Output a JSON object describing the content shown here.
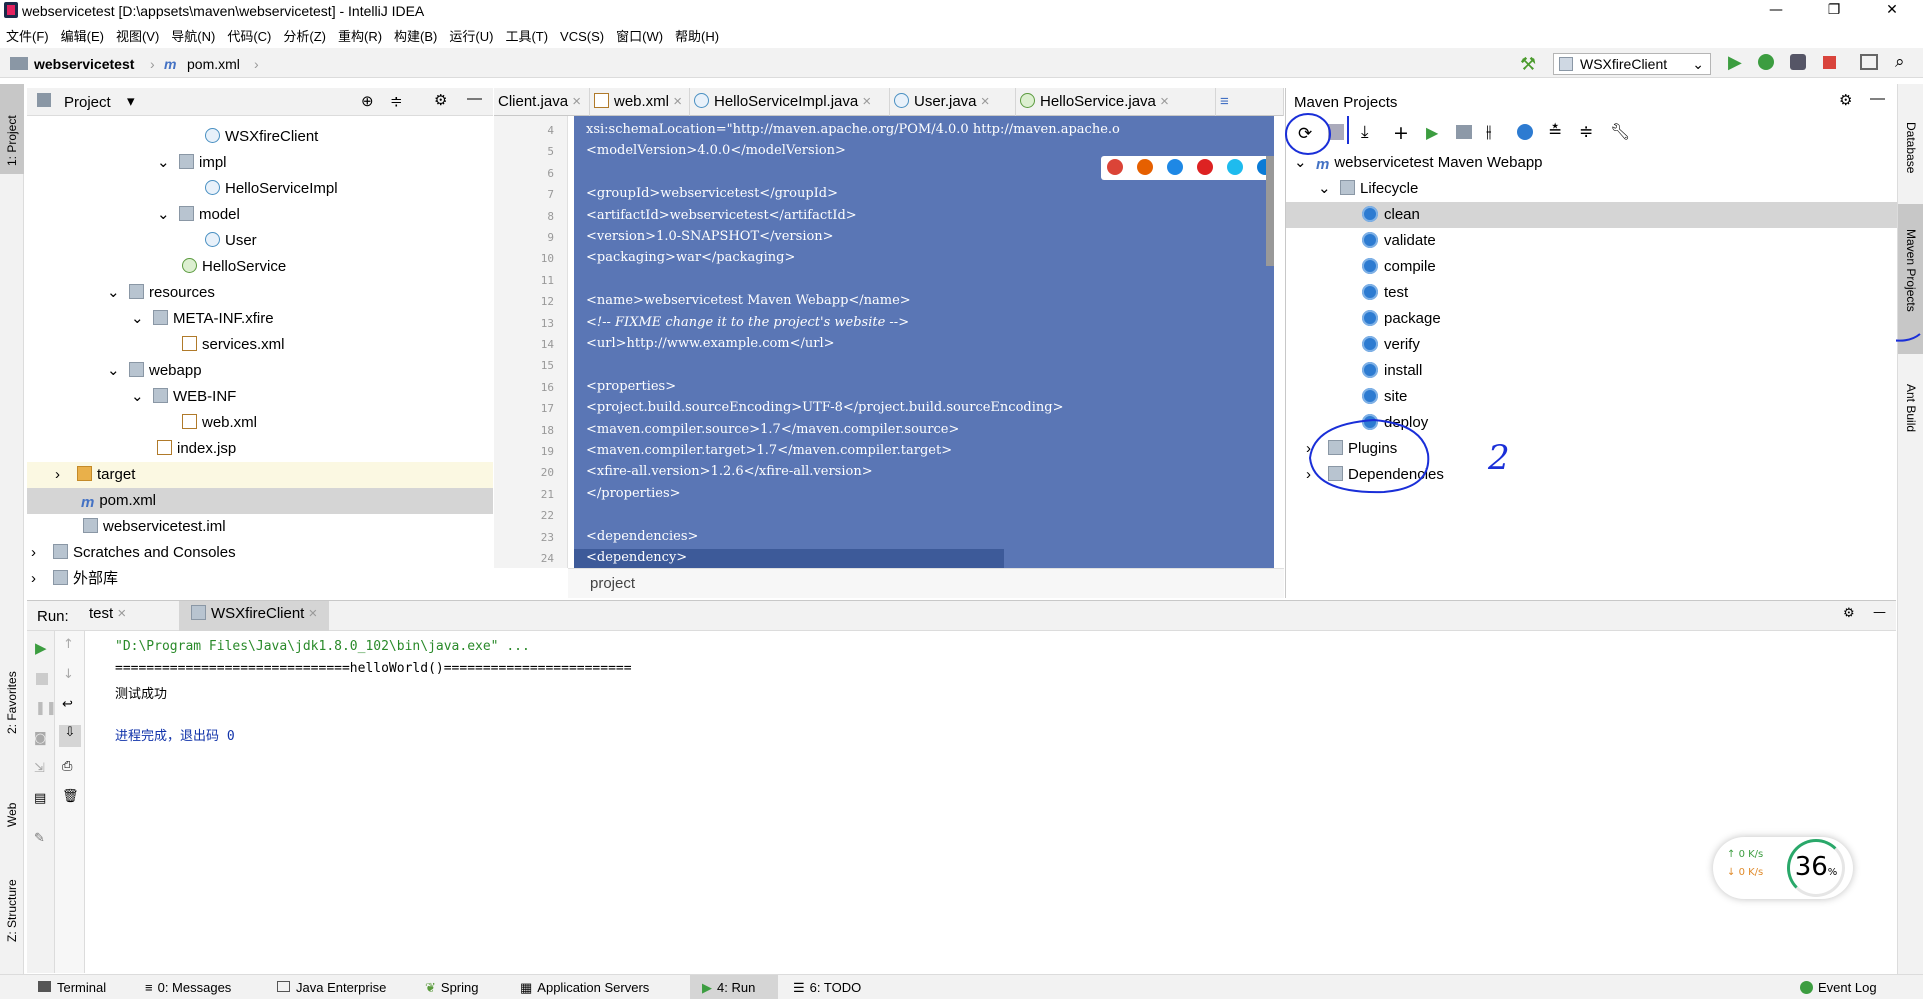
{
  "window": {
    "title": "webservicetest [D:\\appsets\\maven\\webservicetest] - IntelliJ IDEA",
    "minimize": "—",
    "restore": "❐",
    "close": "✕"
  },
  "menu": [
    "文件(F)",
    "编辑(E)",
    "视图(V)",
    "导航(N)",
    "代码(C)",
    "分析(Z)",
    "重构(R)",
    "构建(B)",
    "运行(U)",
    "工具(T)",
    "VCS(S)",
    "窗口(W)",
    "帮助(H)"
  ],
  "breadcrumb": {
    "project": "webservicetest",
    "file": "pom.xml"
  },
  "run_config": "WSXfireClient",
  "left_strip": {
    "project": "1: Project",
    "favorites": "2: Favorites",
    "web": "Web",
    "structure": "Z: Structure"
  },
  "right_strip": {
    "database": "Database",
    "maven": "Maven Projects",
    "ant": "Ant Build"
  },
  "project_panel": {
    "title": "Project",
    "items": [
      {
        "label": "WSXfireClient",
        "icon": "class-icon"
      },
      {
        "label": "impl",
        "icon": "package-icon"
      },
      {
        "label": "HelloServiceImpl",
        "icon": "class-icon"
      },
      {
        "label": "model",
        "icon": "package-icon"
      },
      {
        "label": "User",
        "icon": "class-icon"
      },
      {
        "label": "HelloService",
        "icon": "interface-icon"
      },
      {
        "label": "resources",
        "icon": "folder-icon"
      },
      {
        "label": "META-INF.xfire",
        "icon": "folder-icon"
      },
      {
        "label": "services.xml",
        "icon": "xml-icon"
      },
      {
        "label": "webapp",
        "icon": "folder-icon"
      },
      {
        "label": "WEB-INF",
        "icon": "folder-icon"
      },
      {
        "label": "web.xml",
        "icon": "xml-icon"
      },
      {
        "label": "index.jsp",
        "icon": "jsp-icon"
      },
      {
        "label": "target",
        "icon": "folder-icon"
      },
      {
        "label": "pom.xml",
        "icon": "maven-icon"
      },
      {
        "label": "webservicetest.iml",
        "icon": "iml-icon"
      },
      {
        "label": "Scratches and Consoles",
        "icon": "scratch-icon"
      },
      {
        "label": "外部库",
        "icon": "library-icon"
      }
    ]
  },
  "editor": {
    "tabs": [
      "Client.java",
      "web.xml",
      "HelloServiceImpl.java",
      "User.java",
      "HelloService.java"
    ],
    "line_numbers": [
      "4",
      "5",
      "6",
      "7",
      "8",
      "9",
      "10",
      "11",
      "12",
      "13",
      "14",
      "15",
      "16",
      "17",
      "18",
      "19",
      "20",
      "21",
      "22",
      "23",
      "24"
    ],
    "lines": [
      "xsi:schemaLocation=\"http://maven.apache.org/POM/4.0.0 http://maven.apache.o",
      "<modelVersion>4.0.0</modelVersion>",
      "",
      "<groupId>webservicetest</groupId>",
      "<artifactId>webservicetest</artifactId>",
      "<version>1.0-SNAPSHOT</version>",
      "<packaging>war</packaging>",
      "",
      "<name>webservicetest Maven Webapp</name>",
      "<!-- FIXME change it to the project's website -->",
      "<url>http://www.example.com</url>",
      "",
      "<properties>",
      "  <project.build.sourceEncoding>UTF-8</project.build.sourceEncoding>",
      "  <maven.compiler.source>1.7</maven.compiler.source>",
      "  <maven.compiler.target>1.7</maven.compiler.target>",
      "  <xfire-all.version>1.2.6</xfire-all.version>",
      "</properties>",
      "",
      "<dependencies>",
      "  <dependency>"
    ],
    "footer": "project"
  },
  "maven": {
    "title": "Maven Projects",
    "root": "webservicetest Maven Webapp",
    "lifecycle": "Lifecycle",
    "goals": [
      "clean",
      "validate",
      "compile",
      "test",
      "package",
      "verify",
      "install",
      "site",
      "deploy"
    ],
    "plugins": "Plugins",
    "dependencies": "Dependencies",
    "annotation": "2"
  },
  "run": {
    "label": "Run:",
    "tabs": [
      "test",
      "WSXfireClient"
    ],
    "output": [
      "\"D:\\Program Files\\Java\\jdk1.8.0_102\\bin\\java.exe\" ...",
      "==============================helloWorld()========================",
      "测试成功",
      "",
      "进程完成，退出码 0"
    ]
  },
  "statusbar": [
    "Terminal",
    "0: Messages",
    "Java Enterprise",
    "Spring",
    "Application Servers",
    "4: Run",
    "6: TODO",
    "Event Log"
  ],
  "network": {
    "up": "0  K/s",
    "down": "0  K/s",
    "percent": "36",
    "unit": "%"
  }
}
